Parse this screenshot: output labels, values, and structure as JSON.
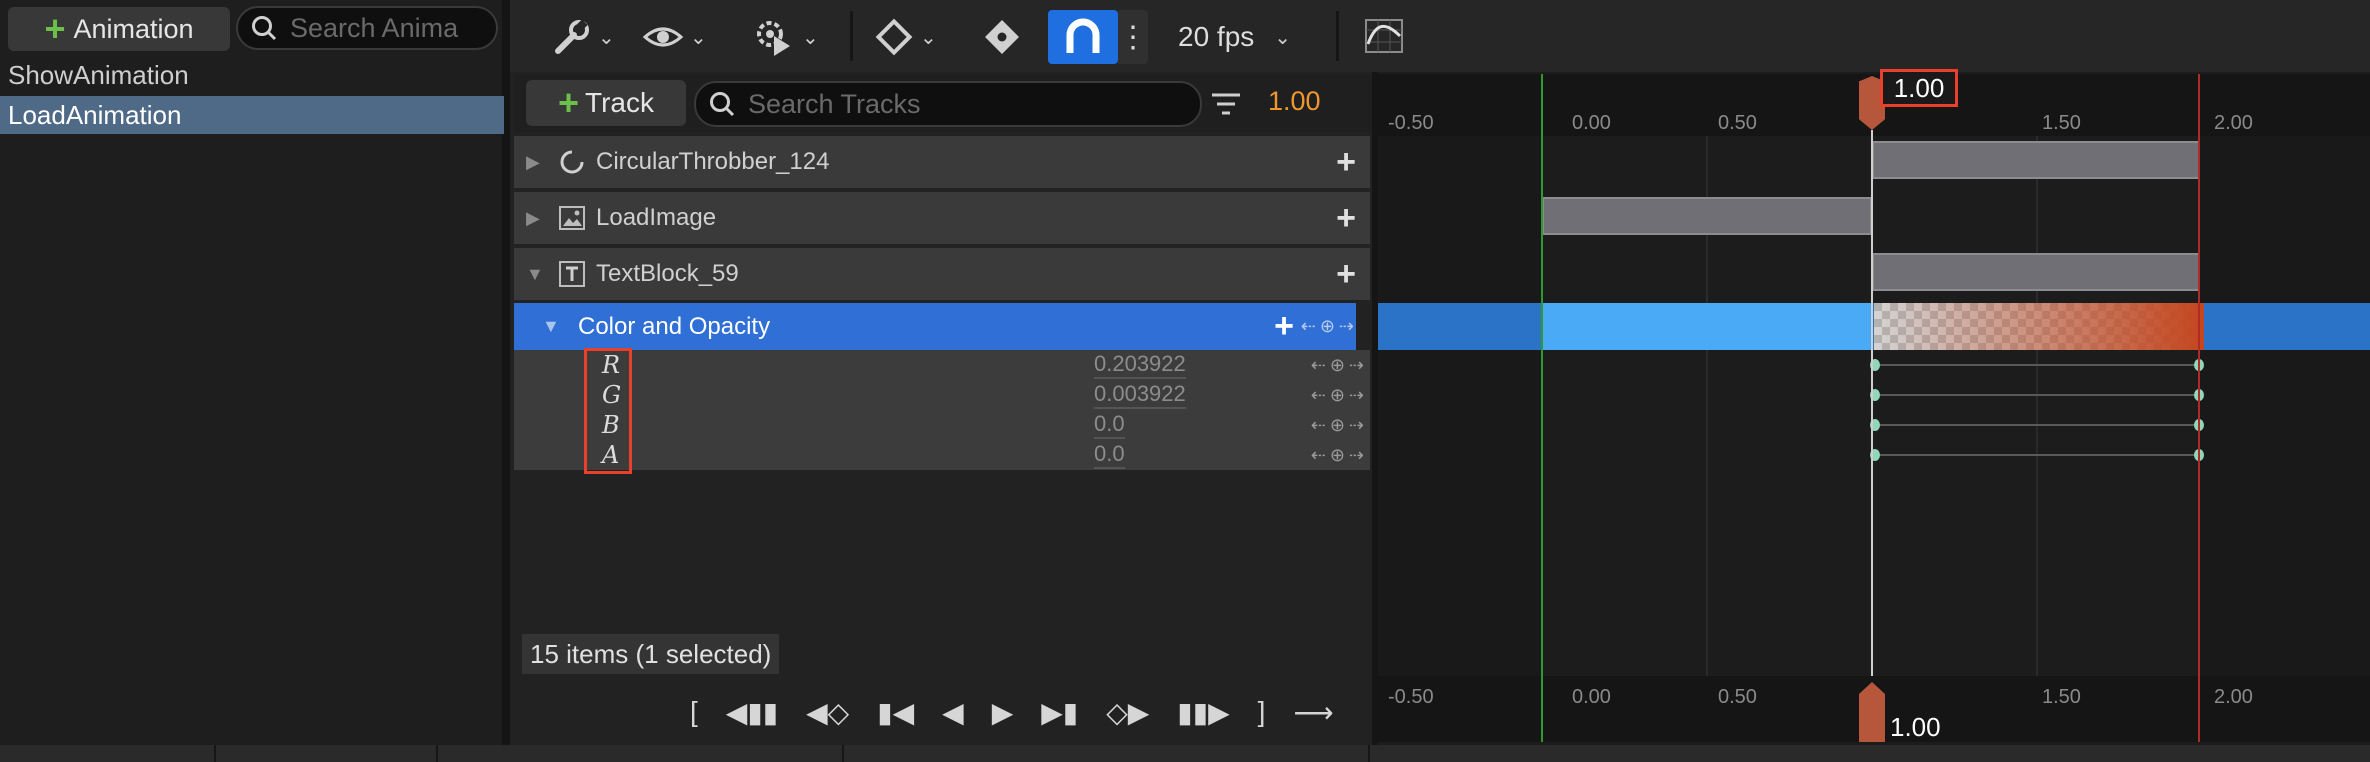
{
  "animations_panel": {
    "add_button_label": "Animation",
    "search_placeholder": "Search Anima",
    "items": [
      {
        "label": "ShowAnimation",
        "selected": false
      },
      {
        "label": "LoadAnimation",
        "selected": true
      }
    ]
  },
  "toolbar": {
    "tools": [
      "wrench-icon",
      "eye-icon",
      "gear-play-icon",
      "keyframe-diamond-icon",
      "key-icon",
      "magnet-snap-icon",
      "curve-editor-icon"
    ],
    "snap_enabled": true,
    "fps_label": "20 fps"
  },
  "tracks_panel": {
    "add_track_label": "Track",
    "search_placeholder": "Search Tracks",
    "current_time": "1.00",
    "tracks": [
      {
        "label": "CircularThrobber_124",
        "icon": "throbber-icon",
        "expanded": false
      },
      {
        "label": "LoadImage",
        "icon": "image-icon",
        "expanded": false
      },
      {
        "label": "TextBlock_59",
        "icon": "text-icon",
        "expanded": true
      }
    ],
    "selected_track": {
      "label": "Color and Opacity"
    },
    "channels": [
      {
        "label": "R",
        "value": "0.203922"
      },
      {
        "label": "G",
        "value": "0.003922"
      },
      {
        "label": "B",
        "value": "0.0"
      },
      {
        "label": "A",
        "value": "0.0"
      }
    ],
    "status": "15 items (1 selected)"
  },
  "timeline": {
    "tick_labels": [
      "-0.50",
      "0.00",
      "0.50",
      "1.00",
      "1.50",
      "2.00"
    ],
    "playhead_time": "1.00",
    "playhead_time_bottom": "1.00",
    "start_time": "0.00",
    "end_time": "2.00",
    "accent_colors": {
      "playhead": "#b6573c",
      "start": "#2f9a2f",
      "end": "#b02a2a",
      "selection": "#2f6fd6"
    }
  }
}
